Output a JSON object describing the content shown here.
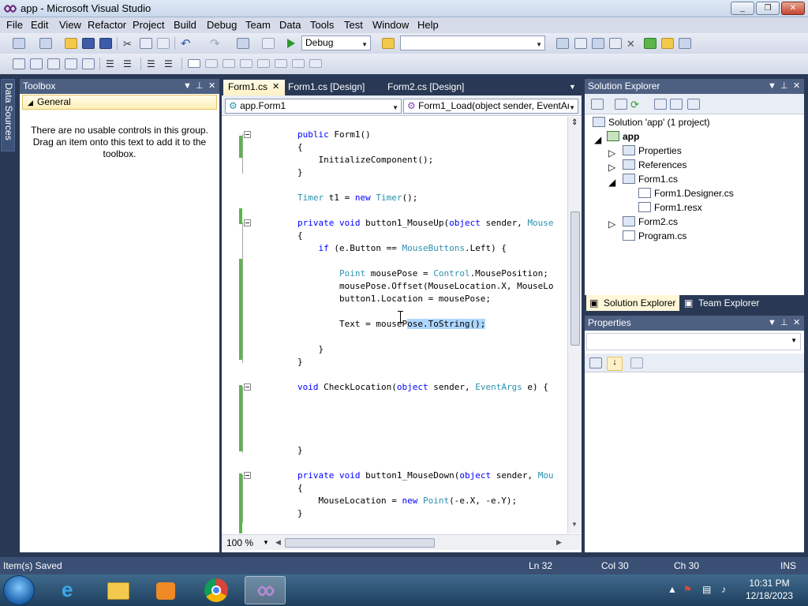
{
  "window": {
    "title": "app - Microsoft Visual Studio",
    "min": "_",
    "max": "❐",
    "close": "✕"
  },
  "menu": [
    "File",
    "Edit",
    "View",
    "Refactor",
    "Project",
    "Build",
    "Debug",
    "Team",
    "Data",
    "Tools",
    "Test",
    "Window",
    "Help"
  ],
  "toolbar": {
    "config": "Debug",
    "platform": ""
  },
  "left_strip": {
    "tab": "Data Sources"
  },
  "toolbox": {
    "title": "Toolbox",
    "group": "General",
    "empty_text": "There are no usable controls in this group. Drag an item onto this text to add it to the toolbox."
  },
  "editor": {
    "tabs": [
      "Form1.cs",
      "Form1.cs [Design]",
      "Form2.cs [Design]"
    ],
    "active_tab_close": "✕",
    "nav_left": "app.Form1",
    "nav_right": "Form1_Load(object sender, EventAr",
    "zoom": "100 %",
    "code": [
      "public Form1()",
      "{",
      "    InitializeComponent();",
      "}",
      "",
      "Timer t1 = new Timer();",
      "",
      "private void button1_MouseUp(object sender, Mouse",
      "{",
      "    if (e.Button == MouseButtons.Left) {",
      "",
      "        Point mousePose = Control.MousePosition;",
      "        mousePose.Offset(MouseLocation.X, MouseLo",
      "        button1.Location = mousePose;",
      "",
      "        Text = mousePose.ToString();",
      "",
      "    }",
      "}",
      "",
      "void CheckLocation(object sender, EventArgs e) {",
      "",
      "",
      "",
      "",
      "}",
      "",
      "private void button1_MouseDown(object sender, Mou",
      "{",
      "    MouseLocation = new Point(-e.X, -e.Y);",
      "}"
    ]
  },
  "solution_explorer": {
    "title": "Solution Explorer",
    "items": [
      {
        "label": "Solution 'app' (1 project)",
        "bold": false
      },
      {
        "label": "app",
        "bold": true
      },
      {
        "label": "Properties",
        "bold": false
      },
      {
        "label": "References",
        "bold": false
      },
      {
        "label": "Form1.cs",
        "bold": false
      },
      {
        "label": "Form1.Designer.cs",
        "bold": false
      },
      {
        "label": "Form1.resx",
        "bold": false
      },
      {
        "label": "Form2.cs",
        "bold": false
      },
      {
        "label": "Program.cs",
        "bold": false
      }
    ],
    "bottom_tabs": [
      "Solution Explorer",
      "Team Explorer"
    ]
  },
  "properties": {
    "title": "Properties"
  },
  "status": {
    "message": "Item(s) Saved",
    "ln": "Ln 32",
    "col": "Col 30",
    "ch": "Ch 30",
    "mode": "INS"
  },
  "clock": {
    "time": "10:31 PM",
    "date": "12/18/2023"
  },
  "colors": {
    "accent": "#293955",
    "tab_active": "#fff1c3",
    "keyword": "#0000ff",
    "type": "#2b91af",
    "change_bar": "#5bb54a"
  }
}
